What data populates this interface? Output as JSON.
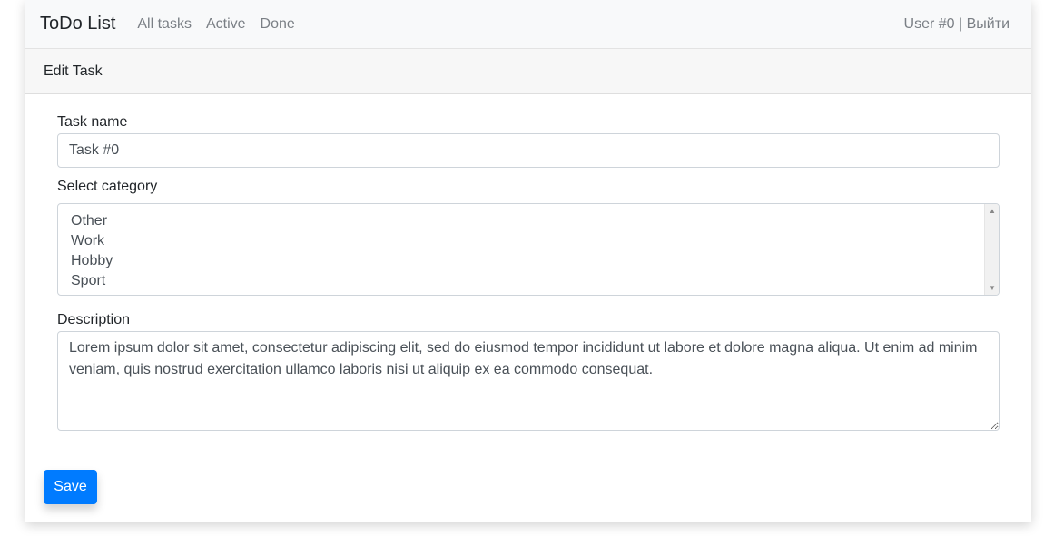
{
  "navbar": {
    "brand": "ToDo List",
    "links": [
      "All tasks",
      "Active",
      "Done"
    ],
    "user": "User #0",
    "separator": " | ",
    "logout": "Выйти"
  },
  "card": {
    "header": "Edit Task"
  },
  "form": {
    "task_name_label": "Task name",
    "task_name_value": "Task #0",
    "category_label": "Select category",
    "categories": [
      "Other",
      "Work",
      "Hobby",
      "Sport"
    ],
    "description_label": "Description",
    "description_value": "Lorem ipsum dolor sit amet, consectetur adipiscing elit, sed do eiusmod tempor incididunt ut labore et dolore magna aliqua. Ut enim ad minim veniam, quis nostrud exercitation ullamco laboris nisi ut aliquip ex ea commodo consequat.",
    "save_label": "Save"
  },
  "colors": {
    "primary": "#007bff",
    "navbar_bg": "#f8f9fa",
    "muted": "#7a7f85"
  }
}
